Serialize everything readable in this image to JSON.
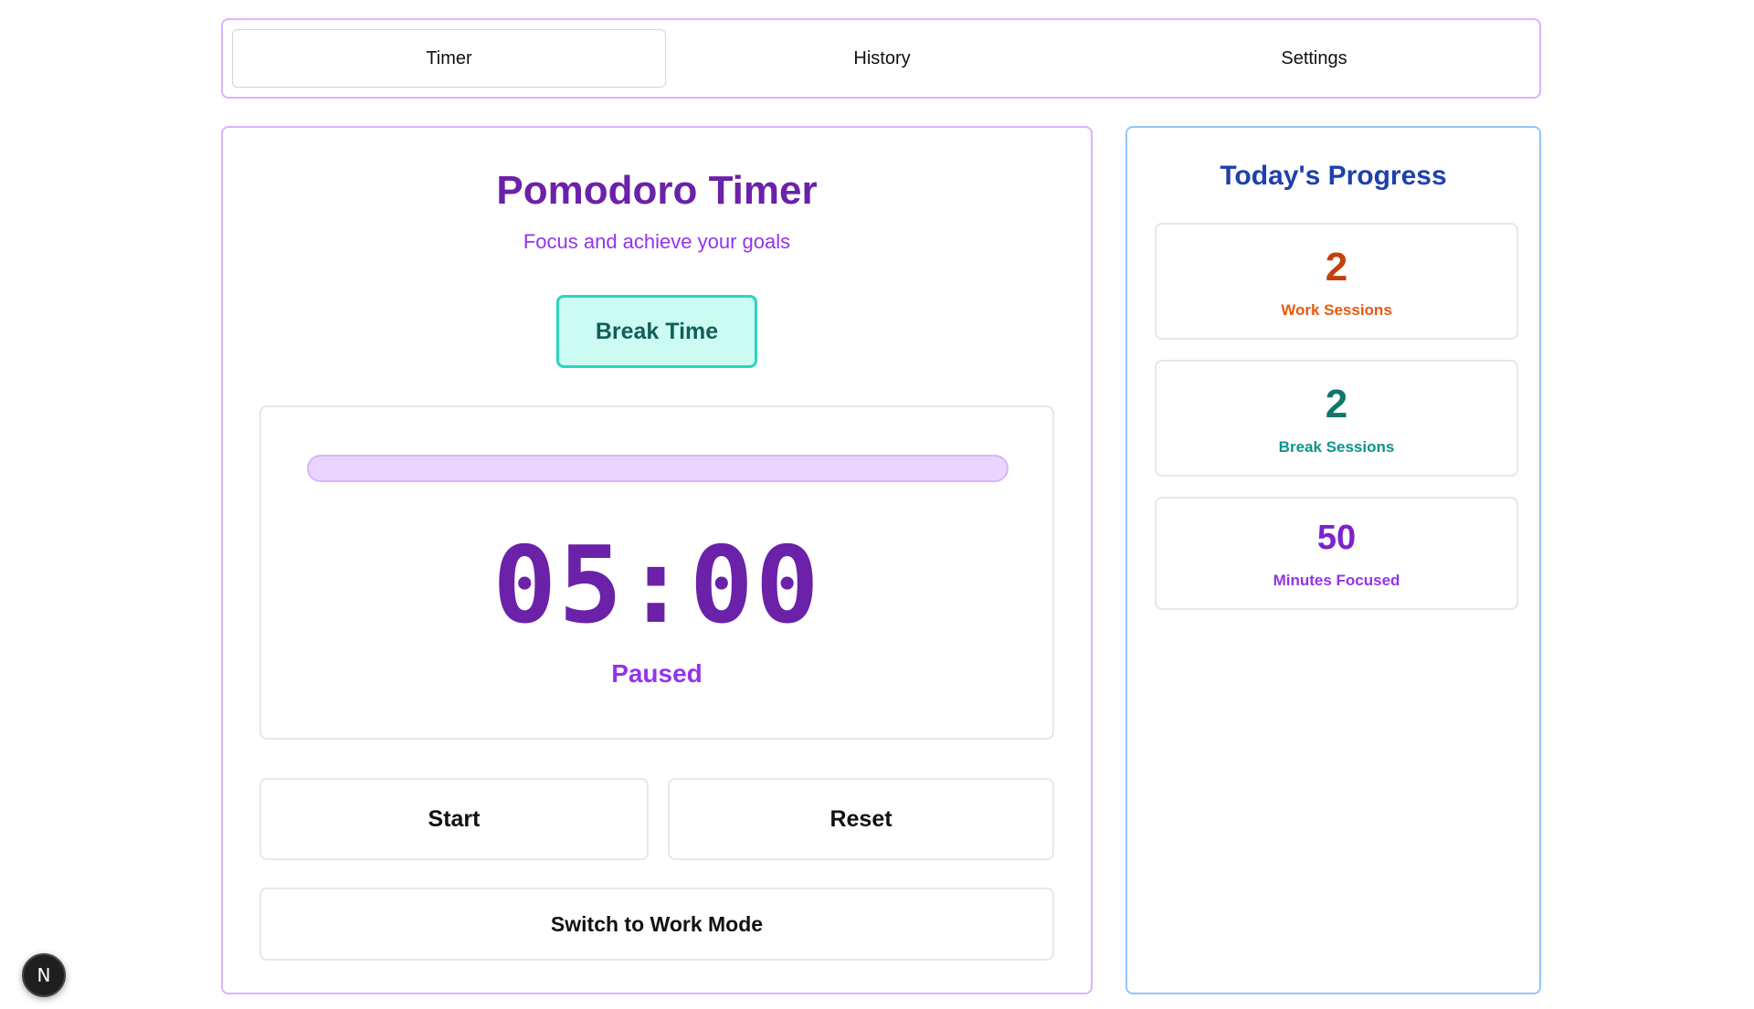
{
  "tabs": [
    {
      "label": "Timer",
      "active": true
    },
    {
      "label": "History",
      "active": false
    },
    {
      "label": "Settings",
      "active": false
    }
  ],
  "timer": {
    "title": "Pomodoro Timer",
    "subtitle": "Focus and achieve your goals",
    "mode_label": "Break Time",
    "progress_percent": 0,
    "time": "05:00",
    "status": "Paused",
    "start_label": "Start",
    "reset_label": "Reset",
    "switch_label": "Switch to Work Mode"
  },
  "progress": {
    "title": "Today's Progress",
    "work_sessions": {
      "value": "2",
      "label": "Work Sessions"
    },
    "break_sessions": {
      "value": "2",
      "label": "Break Sessions"
    },
    "minutes_focused": {
      "value": "50",
      "label": "Minutes Focused"
    }
  },
  "badge": {
    "letter": "N"
  },
  "colors": {
    "accent_purple": "#6b21a8",
    "break_teal": "#2dd4bf",
    "progress_blue": "#1e40af"
  }
}
